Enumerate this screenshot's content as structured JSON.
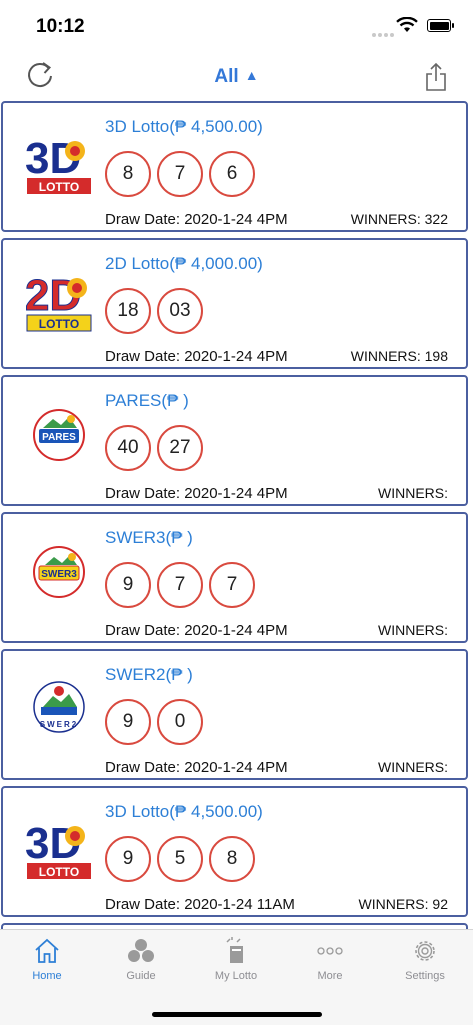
{
  "status": {
    "time": "10:12"
  },
  "nav": {
    "title": "All"
  },
  "cards": [
    {
      "game": "3D Lotto(₱ 4,500.00)",
      "numbers": [
        "8",
        "7",
        "6"
      ],
      "draw": "Draw Date: 2020-1-24 4PM",
      "winners": "WINNERS: 322",
      "logo_text": "3D",
      "logo_sub": "LOTTO",
      "logo_kind": "3d"
    },
    {
      "game": "2D Lotto(₱ 4,000.00)",
      "numbers": [
        "18",
        "03"
      ],
      "draw": "Draw Date: 2020-1-24 4PM",
      "winners": "WINNERS: 198",
      "logo_text": "2D",
      "logo_sub": "LOTTO",
      "logo_kind": "2d"
    },
    {
      "game": "PARES(₱ )",
      "numbers": [
        "40",
        "27"
      ],
      "draw": "Draw Date: 2020-1-24 4PM",
      "winners": "WINNERS:",
      "logo_text": "PARES",
      "logo_sub": "",
      "logo_kind": "pares"
    },
    {
      "game": "SWER3(₱ )",
      "numbers": [
        "9",
        "7",
        "7"
      ],
      "draw": "Draw Date: 2020-1-24 4PM",
      "winners": "WINNERS:",
      "logo_text": "SWER3",
      "logo_sub": "",
      "logo_kind": "swer3"
    },
    {
      "game": "SWER2(₱ )",
      "numbers": [
        "9",
        "0"
      ],
      "draw": "Draw Date: 2020-1-24 4PM",
      "winners": "WINNERS:",
      "logo_text": "SWER2",
      "logo_sub": "",
      "logo_kind": "swer2"
    },
    {
      "game": "3D Lotto(₱ 4,500.00)",
      "numbers": [
        "9",
        "5",
        "8"
      ],
      "draw": "Draw Date: 2020-1-24 11AM",
      "winners": "WINNERS: 92",
      "logo_text": "3D",
      "logo_sub": "LOTTO",
      "logo_kind": "3d"
    }
  ],
  "tabs": [
    {
      "label": "Home",
      "icon": "home-icon",
      "active": true
    },
    {
      "label": "Guide",
      "icon": "guide-icon",
      "active": false
    },
    {
      "label": "My Lotto",
      "icon": "my-lotto-icon",
      "active": false
    },
    {
      "label": "More",
      "icon": "more-icon",
      "active": false
    },
    {
      "label": "Settings",
      "icon": "settings-icon",
      "active": false
    }
  ],
  "colors": {
    "accent": "#2d7fd6",
    "ball_border": "#d94a3f",
    "card_border": "#4b5fa0"
  }
}
